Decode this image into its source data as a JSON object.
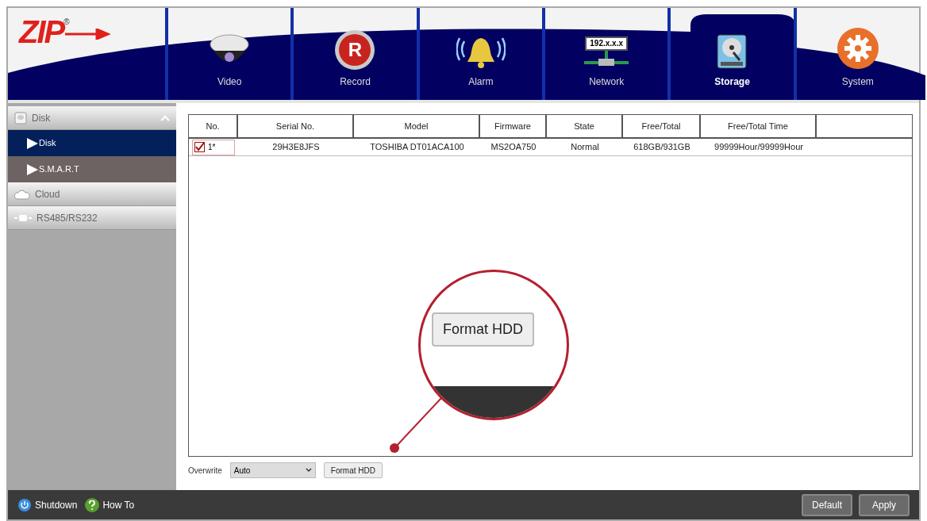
{
  "logo": {
    "text": "ZIP",
    "mark": "®"
  },
  "tabs": [
    {
      "kind": "camera",
      "label": "Video",
      "selected": false
    },
    {
      "kind": "record",
      "label": "Record",
      "selected": false,
      "glyph": "R"
    },
    {
      "kind": "bell",
      "label": "Alarm",
      "selected": false
    },
    {
      "kind": "network",
      "label": "Network",
      "selected": false,
      "glyph": "192.x.x.x"
    },
    {
      "kind": "disk",
      "label": "Storage",
      "selected": true
    },
    {
      "kind": "gear",
      "label": "System",
      "selected": false
    }
  ],
  "sidebar": {
    "items": [
      {
        "kind": "disk",
        "label": "Disk",
        "expanded": true,
        "children": [
          {
            "label": "Disk",
            "selected": true
          },
          {
            "label": "S.M.A.R.T",
            "selected": false
          }
        ]
      },
      {
        "kind": "cloud",
        "label": "Cloud",
        "expanded": false
      },
      {
        "kind": "port",
        "label": "RS485/RS232",
        "expanded": false
      }
    ]
  },
  "table": {
    "columns": [
      "No.",
      "Serial No.",
      "Model",
      "Firmware",
      "State",
      "Free/Total",
      "Free/Total Time"
    ],
    "rows": [
      {
        "checked": true,
        "cells": [
          "1*",
          "29H3E8JFS",
          "TOSHIBA DT01ACA100",
          "MS2OA750",
          "Normal",
          "618GB/931GB",
          "99999Hour/99999Hour"
        ]
      }
    ]
  },
  "overwrite": {
    "label": "Overwrite",
    "value": "Auto"
  },
  "format_button": "Format HDD",
  "callout": {
    "label": "Format HDD"
  },
  "footer": {
    "left": [
      {
        "kind": "power",
        "label": "Shutdown"
      },
      {
        "kind": "help",
        "label": "How To"
      }
    ],
    "buttons": [
      "Default",
      "Apply"
    ]
  }
}
